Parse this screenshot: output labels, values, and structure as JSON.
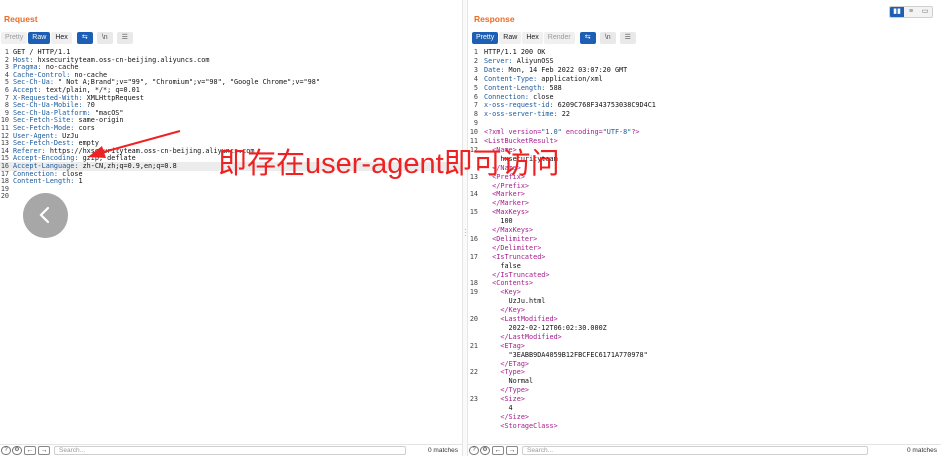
{
  "request": {
    "title": "Request",
    "tabs": [
      {
        "label": "Pretty",
        "state": "muted"
      },
      {
        "label": "Raw",
        "state": "active"
      },
      {
        "label": "Hex",
        "state": "normal"
      }
    ],
    "buttons": [
      "wrap-icon",
      "\\n",
      "menu-icon"
    ],
    "lines": [
      {
        "n": "1",
        "parts": [
          [
            "",
            "GET / HTTP/1.1"
          ]
        ]
      },
      {
        "n": "2",
        "parts": [
          [
            "k",
            "Host:"
          ],
          [
            "",
            " hxsecurityteam.oss-cn-beijing.aliyuncs.com"
          ]
        ]
      },
      {
        "n": "3",
        "parts": [
          [
            "k",
            "Pragma:"
          ],
          [
            "",
            " no-cache"
          ]
        ]
      },
      {
        "n": "4",
        "parts": [
          [
            "k",
            "Cache-Control:"
          ],
          [
            "",
            " no-cache"
          ]
        ]
      },
      {
        "n": "5",
        "parts": [
          [
            "k",
            "Sec-Ch-Ua:"
          ],
          [
            "",
            " \" Not A;Brand\";v=\"99\", \"Chromium\";v=\"98\", \"Google Chrome\";v=\"98\""
          ]
        ]
      },
      {
        "n": "6",
        "parts": [
          [
            "k",
            "Accept:"
          ],
          [
            "",
            " text/plain, */*; q=0.01"
          ]
        ]
      },
      {
        "n": "7",
        "parts": [
          [
            "k",
            "X-Requested-With:"
          ],
          [
            "",
            " XMLHttpRequest"
          ]
        ]
      },
      {
        "n": "8",
        "parts": [
          [
            "k",
            "Sec-Ch-Ua-Mobile:"
          ],
          [
            "",
            " ?0"
          ]
        ]
      },
      {
        "n": "9",
        "parts": [
          [
            "k",
            "Sec-Ch-Ua-Platform:"
          ],
          [
            "",
            " \"macOS\""
          ]
        ]
      },
      {
        "n": "10",
        "parts": [
          [
            "k",
            "Sec-Fetch-Site:"
          ],
          [
            "",
            " same-origin"
          ]
        ]
      },
      {
        "n": "11",
        "parts": [
          [
            "k",
            "Sec-Fetch-Mode:"
          ],
          [
            "",
            " cors"
          ]
        ]
      },
      {
        "n": "12",
        "parts": [
          [
            "k",
            "User-Agent:"
          ],
          [
            "",
            " UzJu"
          ]
        ]
      },
      {
        "n": "13",
        "parts": [
          [
            "k",
            "Sec-Fetch-Dest:"
          ],
          [
            "",
            " empty"
          ]
        ]
      },
      {
        "n": "14",
        "parts": [
          [
            "k",
            "Referer:"
          ],
          [
            "",
            " https://hxsecurityteam.oss-cn-beijing.aliyuncs.com"
          ]
        ]
      },
      {
        "n": "15",
        "parts": [
          [
            "k",
            "Accept-Encoding:"
          ],
          [
            "",
            " gzip, deflate"
          ]
        ]
      },
      {
        "n": "16",
        "parts": [
          [
            "k",
            "Accept-Language:"
          ],
          [
            "",
            " zh-CN,zh;q=0.9,en;q=0.8"
          ]
        ],
        "hl": true
      },
      {
        "n": "17",
        "parts": [
          [
            "k",
            "Connection:"
          ],
          [
            "",
            " close"
          ]
        ]
      },
      {
        "n": "18",
        "parts": [
          [
            "k",
            "Content-Length:"
          ],
          [
            "",
            " 1"
          ]
        ]
      },
      {
        "n": "19",
        "parts": []
      },
      {
        "n": "20",
        "parts": []
      }
    ],
    "search_placeholder": "Search...",
    "matches": "0 matches"
  },
  "response": {
    "title": "Response",
    "tabs": [
      {
        "label": "Pretty",
        "state": "active"
      },
      {
        "label": "Raw",
        "state": "normal"
      },
      {
        "label": "Hex",
        "state": "normal"
      },
      {
        "label": "Render",
        "state": "muted"
      }
    ],
    "buttons": [
      "wrap-icon",
      "\\n",
      "menu-icon"
    ],
    "lines": [
      {
        "n": "1",
        "parts": [
          [
            "",
            "HTTP/1.1 200 OK"
          ]
        ]
      },
      {
        "n": "2",
        "parts": [
          [
            "k",
            "Server:"
          ],
          [
            "",
            " AliyunOSS"
          ]
        ]
      },
      {
        "n": "3",
        "parts": [
          [
            "k",
            "Date:"
          ],
          [
            "",
            " Mon, 14 Feb 2022 03:07:20 GMT"
          ]
        ]
      },
      {
        "n": "4",
        "parts": [
          [
            "k",
            "Content-Type:"
          ],
          [
            "",
            " application/xml"
          ]
        ]
      },
      {
        "n": "5",
        "parts": [
          [
            "k",
            "Content-Length:"
          ],
          [
            "",
            " 588"
          ]
        ]
      },
      {
        "n": "6",
        "parts": [
          [
            "k",
            "Connection:"
          ],
          [
            "",
            " close"
          ]
        ]
      },
      {
        "n": "7",
        "parts": [
          [
            "k",
            "x-oss-request-id:"
          ],
          [
            "",
            " 6209C768F343753038C9D4C1"
          ]
        ]
      },
      {
        "n": "8",
        "parts": [
          [
            "k",
            "x-oss-server-time:"
          ],
          [
            "",
            " 22"
          ]
        ]
      },
      {
        "n": "9",
        "parts": []
      },
      {
        "n": "10",
        "parts": [
          [
            "tag",
            "<?xml version="
          ],
          [
            "k",
            "\"1.0\""
          ],
          [
            "tag",
            " encoding="
          ],
          [
            "k",
            "\"UTF-8\""
          ],
          [
            "tag",
            "?>"
          ]
        ]
      },
      {
        "n": "11",
        "parts": [
          [
            "tag",
            "<ListBucketResult>"
          ]
        ]
      },
      {
        "n": "12",
        "parts": [
          [
            "tag",
            "  <Name>"
          ]
        ]
      },
      {
        "n": "",
        "parts": [
          [
            "",
            "    hxsecurityteam"
          ]
        ]
      },
      {
        "n": "",
        "parts": [
          [
            "tag",
            "  </Name>"
          ]
        ]
      },
      {
        "n": "13",
        "parts": [
          [
            "tag",
            "  <Prefix>"
          ]
        ]
      },
      {
        "n": "",
        "parts": [
          [
            "tag",
            "  </Prefix>"
          ]
        ]
      },
      {
        "n": "14",
        "parts": [
          [
            "tag",
            "  <Marker>"
          ]
        ]
      },
      {
        "n": "",
        "parts": [
          [
            "tag",
            "  </Marker>"
          ]
        ]
      },
      {
        "n": "15",
        "parts": [
          [
            "tag",
            "  <MaxKeys>"
          ]
        ]
      },
      {
        "n": "",
        "parts": [
          [
            "",
            "    100"
          ]
        ]
      },
      {
        "n": "",
        "parts": [
          [
            "tag",
            "  </MaxKeys>"
          ]
        ]
      },
      {
        "n": "16",
        "parts": [
          [
            "tag",
            "  <Delimiter>"
          ]
        ]
      },
      {
        "n": "",
        "parts": [
          [
            "tag",
            "  </Delimiter>"
          ]
        ]
      },
      {
        "n": "17",
        "parts": [
          [
            "tag",
            "  <IsTruncated>"
          ]
        ]
      },
      {
        "n": "",
        "parts": [
          [
            "",
            "    false"
          ]
        ]
      },
      {
        "n": "",
        "parts": [
          [
            "tag",
            "  </IsTruncated>"
          ]
        ]
      },
      {
        "n": "18",
        "parts": [
          [
            "tag",
            "  <Contents>"
          ]
        ]
      },
      {
        "n": "19",
        "parts": [
          [
            "tag",
            "    <Key>"
          ]
        ]
      },
      {
        "n": "",
        "parts": [
          [
            "",
            "      UzJu.html"
          ]
        ]
      },
      {
        "n": "",
        "parts": [
          [
            "tag",
            "    </Key>"
          ]
        ]
      },
      {
        "n": "20",
        "parts": [
          [
            "tag",
            "    <LastModified>"
          ]
        ]
      },
      {
        "n": "",
        "parts": [
          [
            "",
            "      2022-02-12T06:02:30.000Z"
          ]
        ]
      },
      {
        "n": "",
        "parts": [
          [
            "tag",
            "    </LastModified>"
          ]
        ]
      },
      {
        "n": "21",
        "parts": [
          [
            "tag",
            "    <ETag>"
          ]
        ]
      },
      {
        "n": "",
        "parts": [
          [
            "",
            "      \"3EABB9DA4059B12FBCFEC6171A770978\""
          ]
        ]
      },
      {
        "n": "",
        "parts": [
          [
            "tag",
            "    </ETag>"
          ]
        ]
      },
      {
        "n": "22",
        "parts": [
          [
            "tag",
            "    <Type>"
          ]
        ]
      },
      {
        "n": "",
        "parts": [
          [
            "",
            "      Normal"
          ]
        ]
      },
      {
        "n": "",
        "parts": [
          [
            "tag",
            "    </Type>"
          ]
        ]
      },
      {
        "n": "23",
        "parts": [
          [
            "tag",
            "    <Size>"
          ]
        ]
      },
      {
        "n": "",
        "parts": [
          [
            "",
            "      4"
          ]
        ]
      },
      {
        "n": "",
        "parts": [
          [
            "tag",
            "    </Size>"
          ]
        ]
      },
      {
        "n": "",
        "parts": [
          [
            "tag",
            "    <StorageClass>"
          ]
        ]
      }
    ],
    "search_placeholder": "Search...",
    "matches": "0 matches"
  },
  "annotation": {
    "text": "即存在user-agent即可访问",
    "color": "#ee2222"
  },
  "colors": {
    "accent": "#1d5fb4",
    "title": "#ec6a24",
    "header_key": "#19599d",
    "xml_tag": "#a7198e"
  }
}
